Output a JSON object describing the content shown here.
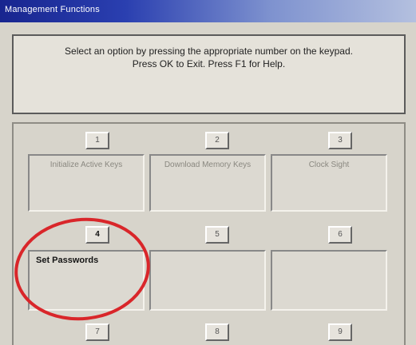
{
  "window": {
    "title": "Management Functions"
  },
  "instruction": {
    "line1": "Select an option by pressing the appropriate number on the keypad.",
    "line2": "Press OK to Exit. Press F1 for Help."
  },
  "options": [
    {
      "number": "1",
      "label": "Initialize Active Keys"
    },
    {
      "number": "2",
      "label": "Download Memory Keys"
    },
    {
      "number": "3",
      "label": "Clock Sight"
    },
    {
      "number": "4",
      "label": "Set Passwords"
    },
    {
      "number": "5",
      "label": ""
    },
    {
      "number": "6",
      "label": ""
    },
    {
      "number": "7",
      "label": ""
    },
    {
      "number": "8",
      "label": ""
    },
    {
      "number": "9",
      "label": ""
    }
  ],
  "colors": {
    "highlight_circle": "#d9262a",
    "titlebar_start": "#18258f",
    "titlebar_end": "#b4c0df"
  },
  "highlighted_option": "4"
}
